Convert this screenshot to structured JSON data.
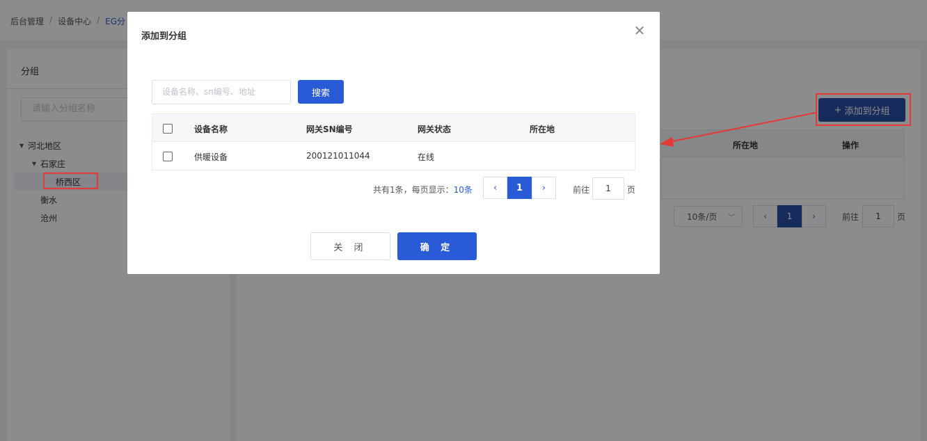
{
  "breadcrumb": [
    "后台管理",
    "设备中心",
    "EG分"
  ],
  "left_panel": {
    "title": "分组",
    "search_placeholder": "请输入分组名称",
    "tree": {
      "root": "河北地区",
      "child": "石家庄",
      "grandchild_selected": "桥西区",
      "sibling1": "衡水",
      "sibling2": "沧州"
    }
  },
  "right_panel": {
    "add_button": "添加到分组",
    "columns": {
      "location": "所在地",
      "action": "操作"
    },
    "page_size": "10条/页",
    "current_page": "1",
    "goto_prefix": "前往",
    "goto_value": "1",
    "goto_suffix": "页"
  },
  "modal": {
    "title": "添加到分组",
    "search_placeholder": "设备名称、sn编号、地址",
    "search_button": "搜索",
    "columns": {
      "name": "设备名称",
      "sn": "网关SN编号",
      "status": "网关状态",
      "location": "所在地"
    },
    "rows": [
      {
        "name": "供暖设备",
        "sn": "200121011044",
        "status": "在线",
        "location": ""
      }
    ],
    "pagination": {
      "total_prefix": "共有1条，每页显示：",
      "page_size": "10条",
      "current_page": "1",
      "goto_prefix": "前往",
      "goto_value": "1",
      "goto_suffix": "页"
    },
    "close_button": "关 闭",
    "ok_button": "确 定"
  },
  "colors": {
    "primary": "#2a5bd7",
    "annotation_red": "#e53935"
  }
}
